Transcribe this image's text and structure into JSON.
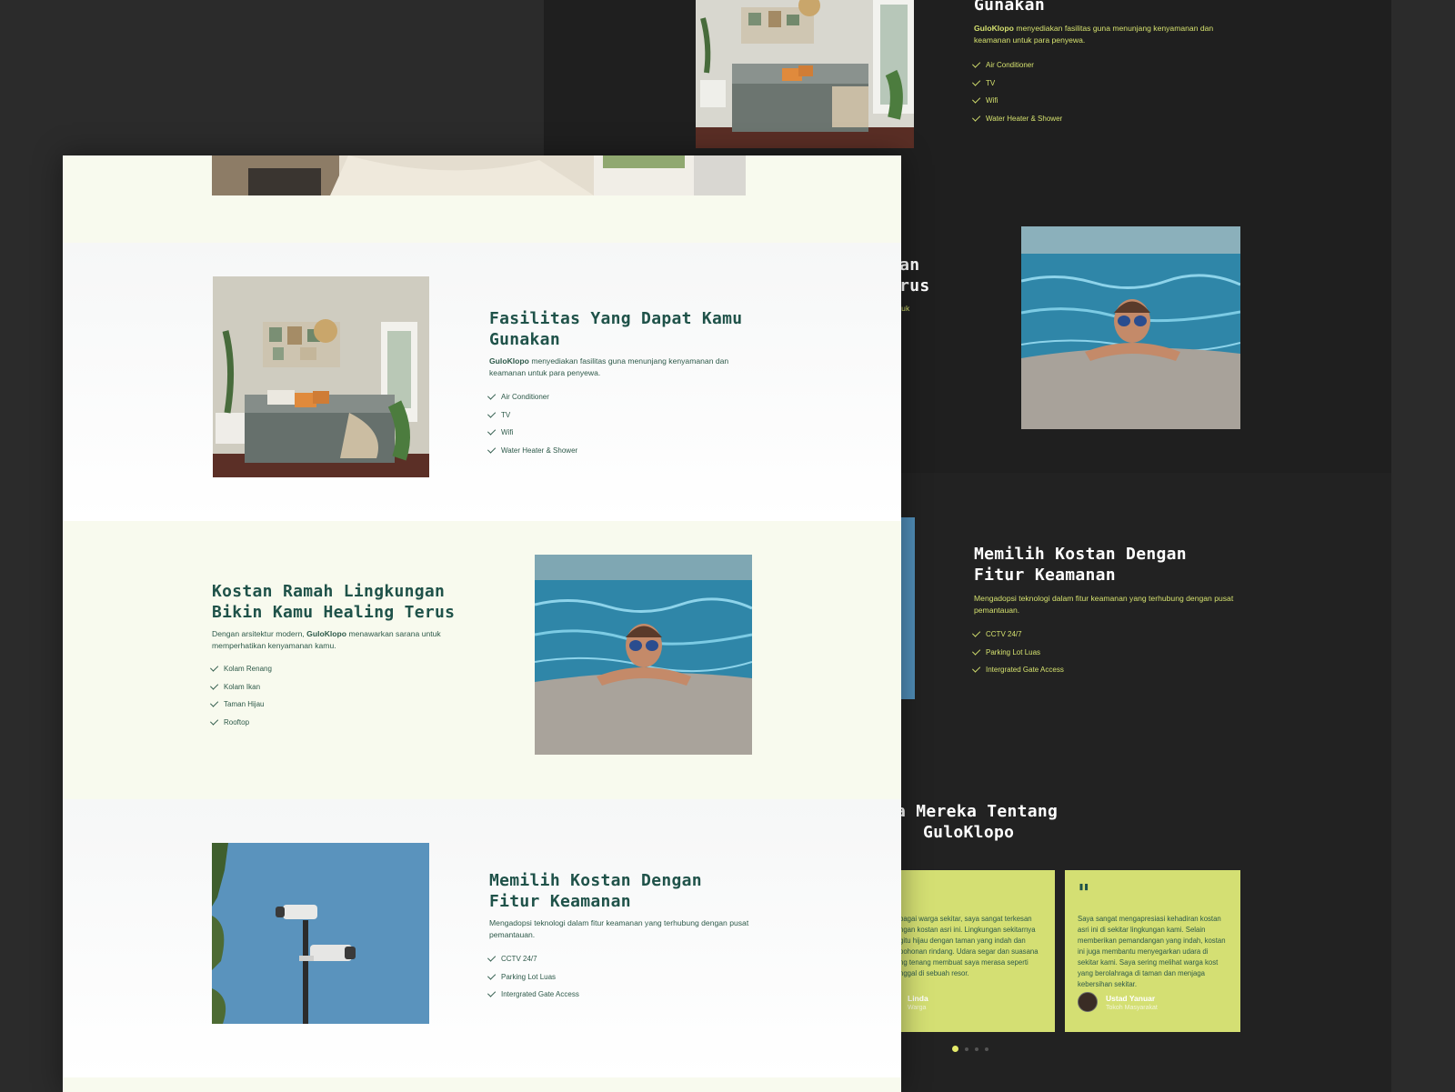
{
  "brand": "GuloKlopo",
  "light_page": {
    "facilities": {
      "title": "Fasilitas Yang Dapat Kamu Gunakan",
      "brand": "GuloKlopo",
      "desc": "menyediakan fasilitas guna menunjang kenyamanan dan keamanan untuk para penyewa.",
      "items": [
        "Air Conditioner",
        "TV",
        "Wifi",
        "Water Heater & Shower"
      ]
    },
    "eco": {
      "title": "Kostan Ramah Lingkungan Bikin Kamu Healing Terus",
      "desc_prefix": "Dengan arsitektur modern,",
      "brand": "GuloKlopo",
      "desc_suffix": "menawarkan sarana untuk memperhatikan kenyamanan kamu.",
      "items": [
        "Kolam Renang",
        "Kolam Ikan",
        "Taman Hijau",
        "Rooftop"
      ]
    },
    "security": {
      "title": "Memilih Kostan Dengan Fitur Keamanan",
      "desc": "Mengadopsi teknologi dalam fitur keamanan yang terhubung dengan pusat pemantauan.",
      "items": [
        "CCTV 24/7",
        "Parking Lot Luas",
        "Intergrated Gate Access"
      ]
    }
  },
  "dark_page": {
    "facilities": {
      "title_fragment": "Gunakan",
      "brand": "GuloKlopo",
      "desc": "menyediakan fasilitas guna menunjang kenyamanan dan keamanan untuk para penyewa.",
      "items": [
        "Air Conditioner",
        "TV",
        "Wifi",
        "Water Heater & Shower"
      ]
    },
    "eco_fragment": {
      "line1": "gan",
      "line2": "erus",
      "line3": "ntuk"
    },
    "security": {
      "title": "Memilih Kostan Dengan Fitur Keamanan",
      "desc": "Mengadopsi teknologi dalam fitur keamanan yang terhubung dengan pusat pemantauan.",
      "items": [
        "CCTV 24/7",
        "Parking Lot Luas",
        "Intergrated Gate Access"
      ]
    },
    "testimonials": {
      "title_line1": "a Mereka Tentang",
      "title_line2": "GuloKlopo",
      "quote_mark": "\"",
      "cards": [
        {
          "text": "bagai warga sekitar, saya sangat terkesan ngan kostan asri ini. Lingkungan sekitarnya gitu hijau dengan taman yang indah dan pohonan rindang. Udara segar dan suasana ng tenang membuat saya merasa seperti nggal di sebuah resor.",
          "name": "Linda",
          "role": "Warga"
        },
        {
          "text": "Saya sangat mengapresiasi kehadiran kostan asri ini di sekitar lingkungan kami. Selain memberikan pemandangan yang indah, kostan ini juga membantu menyegarkan udara di sekitar kami. Saya sering melihat warga kost yang berolahraga di taman dan menjaga kebersihan sekitar.",
          "name": "Ustad Yanuar",
          "role": "Tokoh Masyarakat"
        }
      ],
      "slide_count": 4,
      "active_slide": 1
    }
  },
  "colors": {
    "dark_bg": "#1f1f1f",
    "accent_lime": "#d4df73",
    "text_green": "#1f5249",
    "cream_bg": "#f8faee"
  }
}
